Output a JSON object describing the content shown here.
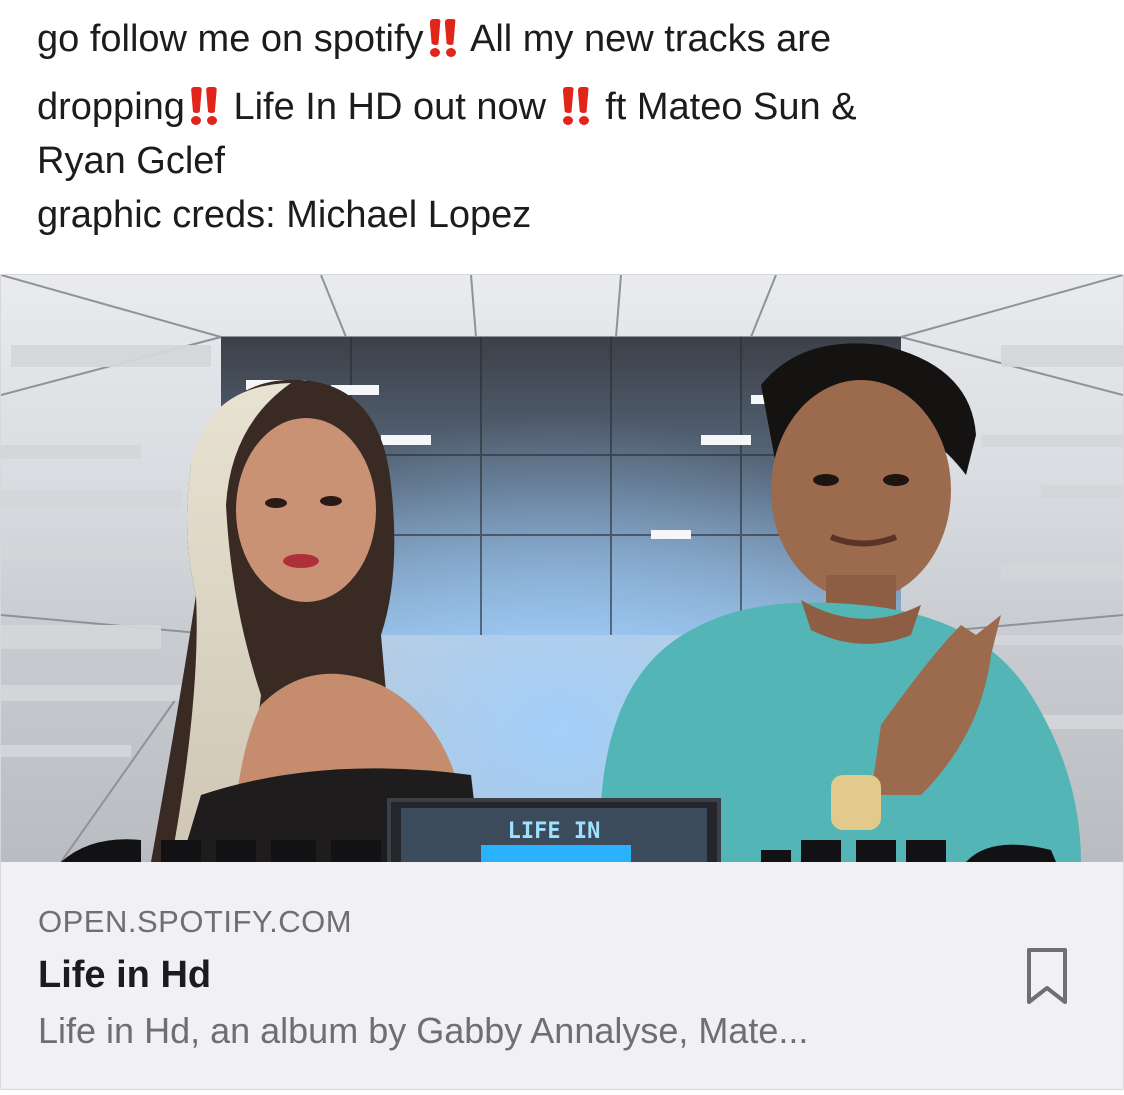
{
  "post": {
    "line1_a": "go follow me on spotify",
    "line1_b": " All my new tracks are",
    "line2_a": "dropping",
    "line2_b": " Life In HD out now ",
    "line2_c": " ft Mateo Sun &",
    "line3": "Ryan Gclef",
    "line4": "graphic creds: Michael Lopez",
    "emoji_name": "double-exclamation-icon",
    "emoji_color": "#e1251b"
  },
  "link_card": {
    "cover_text": "LIFE IN",
    "domain": "OPEN.SPOTIFY.COM",
    "title": "Life in Hd",
    "description": "Life in Hd, an album by Gabby Annalyse, Mate...",
    "bookmark_icon": "bookmark-icon"
  },
  "colors": {
    "text": "#1c1c1e",
    "secondary_text": "#6e6e73",
    "card_background": "#f1f1f3"
  }
}
